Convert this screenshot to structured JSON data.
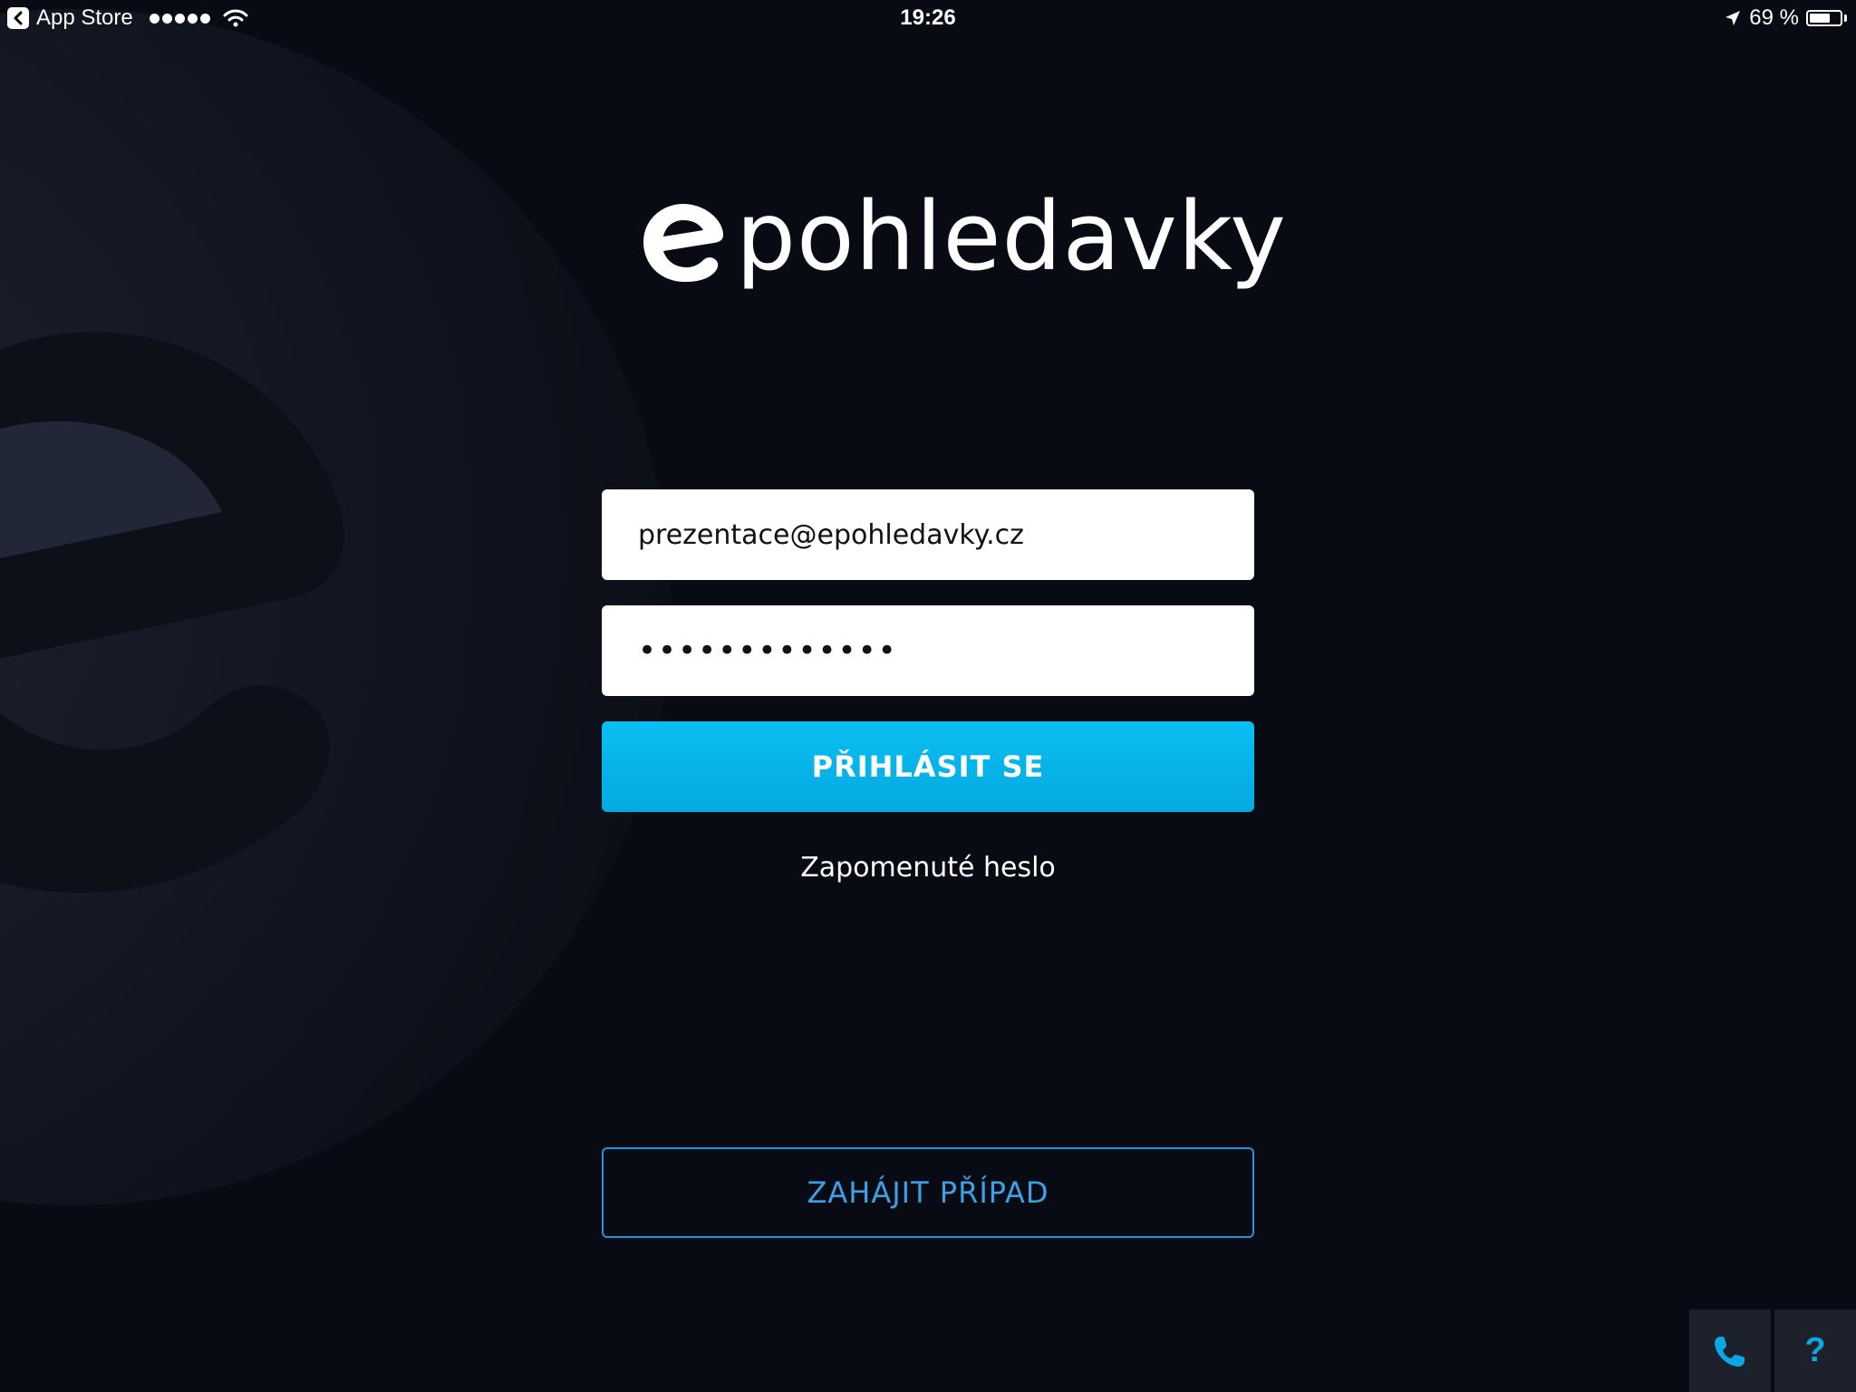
{
  "status_bar": {
    "back_label": "App Store",
    "time": "19:26",
    "battery_percent": "69 %",
    "battery_level": 0.69,
    "signal_dots": 5
  },
  "logo": {
    "text": "pohledavky"
  },
  "login_form": {
    "email_value": "prezentace@epohledavky.cz",
    "password_mask": "•••••••••••••",
    "login_button_label": "PŘIHLÁSIT SE",
    "forgot_password_label": "Zapomenuté heslo"
  },
  "start_case_button_label": "ZAHÁJIT PŘÍPAD",
  "corner_buttons": {
    "phone_icon": "phone-icon",
    "help_label": "?"
  },
  "colors": {
    "background": "#080b14",
    "accent": "#03b4ea",
    "outline_accent": "#2b90d9",
    "watermark": "#1a1f2c"
  }
}
